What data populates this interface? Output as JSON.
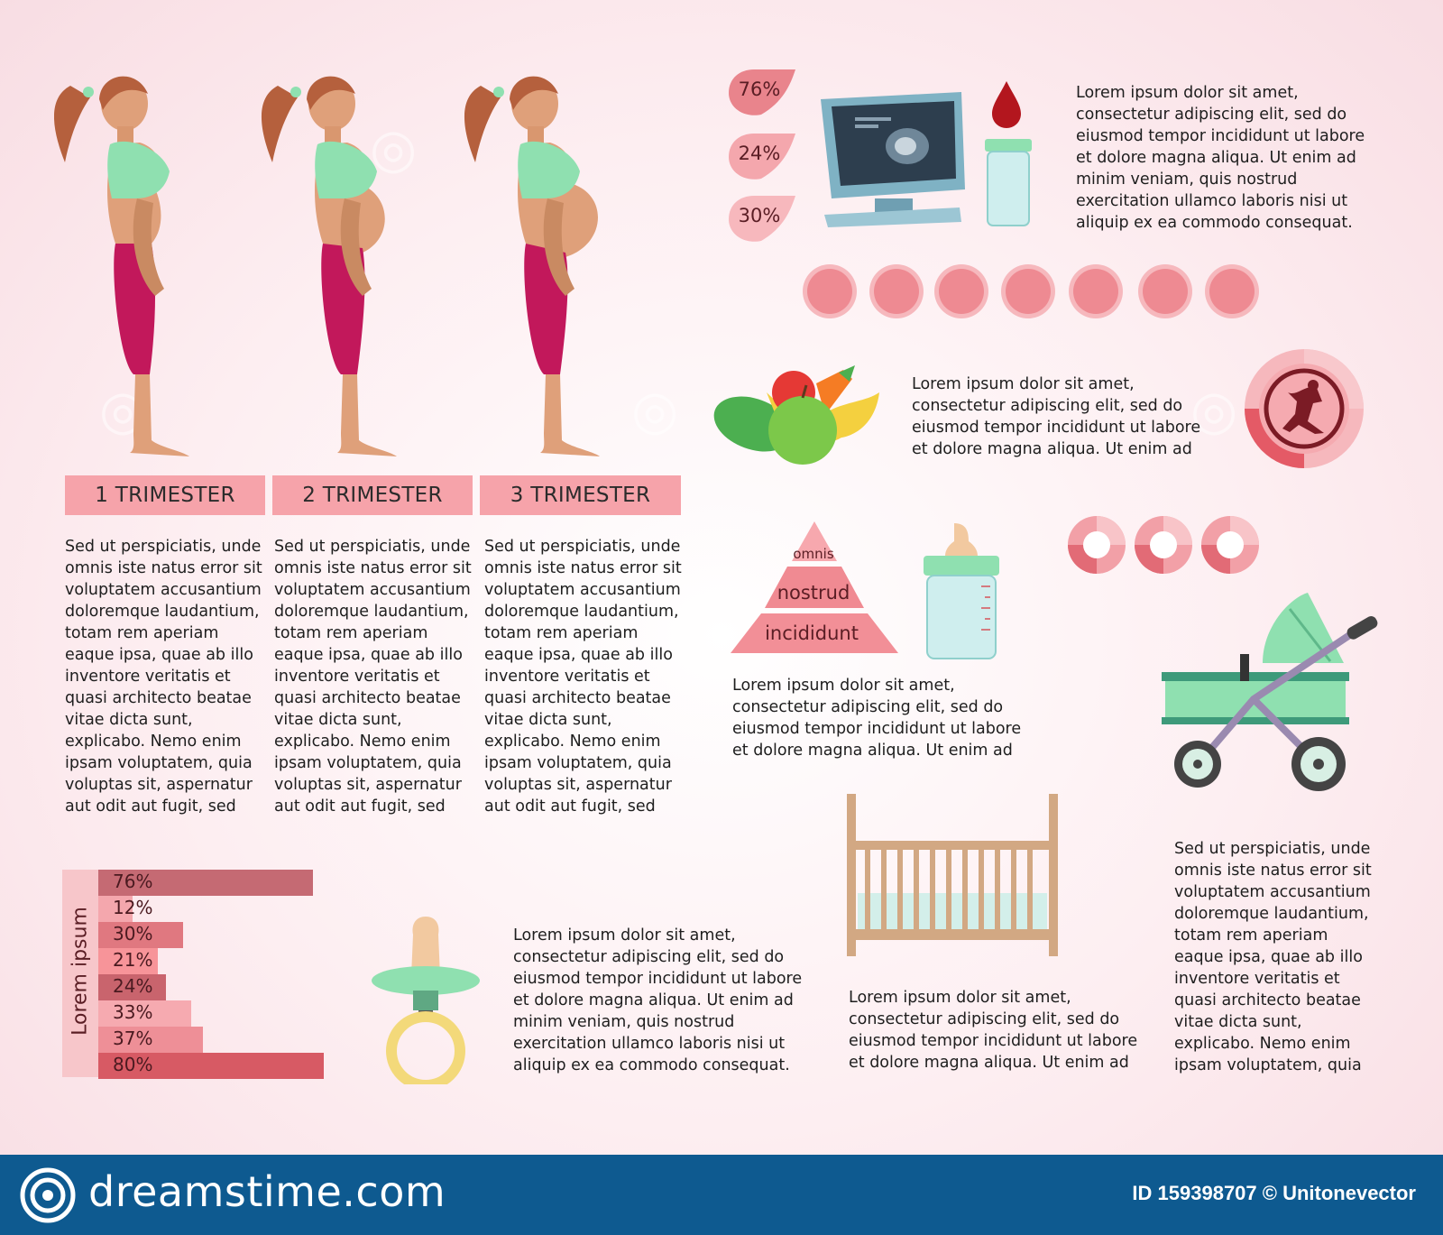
{
  "trimesters": {
    "labels": [
      "1 TRIMESTER",
      "2 TRIMESTER",
      "3 TRIMESTER"
    ],
    "body_text": "Sed ut perspiciatis, unde\nomnis iste natus error sit\nvoluptatem accusantium\ndoloremque laudantium,\ntotam rem aperiam\neaque ipsa, quae ab illo\ninventore veritatis et\nquasi architecto beatae\nvitae dicta sunt,\nexplicabo. Nemo enim\nipsam voluptatem, quia\nvoluptas sit, aspernatur\naut odit aut fugit, sed"
  },
  "drops": [
    "76%",
    "24%",
    "30%"
  ],
  "texts": {
    "top_right": "Lorem ipsum dolor sit amet,\nconsectetur adipiscing elit, sed do\neiusmod tempor incididunt ut labore\net dolore magna aliqua. Ut enim ad\nminim veniam, quis nostrud\nexercitation ullamco laboris nisi ut\naliquip ex ea commodo consequat.",
    "fruit": "Lorem ipsum dolor sit amet,\nconsectetur adipiscing elit, sed do\neiusmod tempor incididunt ut labore\net dolore magna aliqua. Ut enim ad",
    "pyramid": "Lorem ipsum dolor sit amet,\nconsectetur adipiscing elit, sed do\neiusmod tempor incididunt ut labore\net dolore magna aliqua. Ut enim ad",
    "pacifier": "Lorem ipsum dolor sit amet,\nconsectetur adipiscing elit, sed do\neiusmod tempor incididunt ut labore\net dolore magna aliqua. Ut enim ad\nminim veniam, quis nostrud\nexercitation ullamco laboris nisi ut\naliquip ex ea commodo consequat.",
    "crib": "Lorem ipsum dolor sit amet,\nconsectetur adipiscing elit, sed do\neiusmod tempor incididunt ut labore\net dolore magna aliqua. Ut enim ad",
    "stroller": "Sed ut perspiciatis, unde\nomnis iste natus error sit\nvoluptatem accusantium\ndoloremque laudantium,\ntotam rem aperiam\neaque ipsa, quae ab illo\ninventore veritatis et\nquasi architecto beatae\nvitae dicta sunt,\nexplicabo. Nemo enim\nipsam voluptatem, quia"
  },
  "pyramid": {
    "levels": [
      "omnis",
      "nostrud",
      "incididunt"
    ]
  },
  "bar_chart": {
    "axis_label": "Lorem ipsum",
    "labels": [
      "76%",
      "12%",
      "30%",
      "21%",
      "24%",
      "33%",
      "37%",
      "80%"
    ],
    "values": [
      76,
      12,
      30,
      21,
      24,
      33,
      37,
      80
    ],
    "colors": [
      "#c56a73",
      "#f4a7ad",
      "#e07880",
      "#f79499",
      "#c9646d",
      "#f6aab0",
      "#ee8f97",
      "#d75a64"
    ]
  },
  "footer": {
    "site": "dreamstime.com",
    "image_id": "ID 159398707 © Unitonevector"
  },
  "colors": {
    "pink_label": "#f6a3aa",
    "rose": "#e9848c",
    "mint": "#8fe0b0",
    "magenta": "#c2185b",
    "skin": "#e0a37a",
    "footer": "#0e5a90"
  }
}
